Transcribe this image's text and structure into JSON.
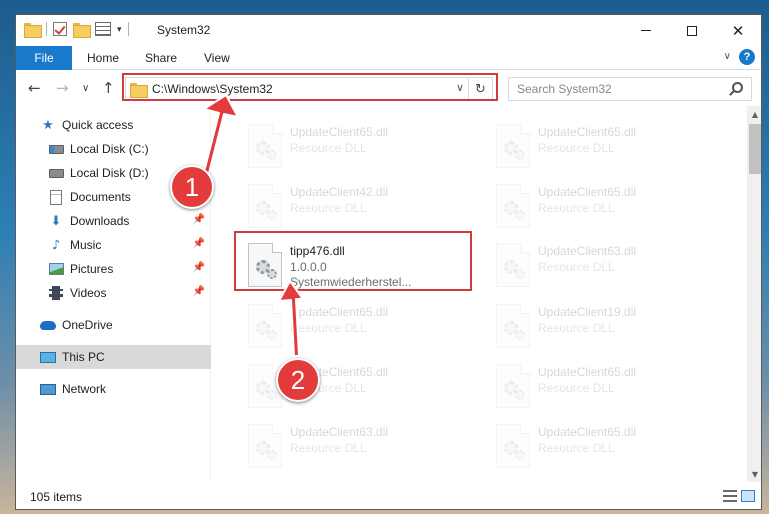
{
  "window": {
    "title": "System32",
    "controls": {
      "minimize": "minimize-icon",
      "maximize": "maximize-icon",
      "close": "✕"
    }
  },
  "ribbon": {
    "file_tab": "File",
    "tabs": [
      "Home",
      "Share",
      "View"
    ],
    "help": "?"
  },
  "navigation": {
    "address": "C:\\Windows\\System32",
    "search_placeholder": "Search System32"
  },
  "sidebar": {
    "items": [
      {
        "label": "Quick access",
        "icon": "star-icon"
      },
      {
        "label": "Local Disk (C:)",
        "icon": "drive-icon",
        "pinned": false
      },
      {
        "label": "Local Disk (D:)",
        "icon": "drive-icon",
        "pinned": false
      },
      {
        "label": "Documents",
        "icon": "document-icon",
        "pinned": false
      },
      {
        "label": "Downloads",
        "icon": "download-icon",
        "pinned": true
      },
      {
        "label": "Music",
        "icon": "music-icon",
        "pinned": true
      },
      {
        "label": "Pictures",
        "icon": "pictures-icon",
        "pinned": true
      },
      {
        "label": "Videos",
        "icon": "videos-icon",
        "pinned": true
      },
      {
        "label": "OneDrive",
        "icon": "cloud-icon"
      },
      {
        "label": "This PC",
        "icon": "computer-icon",
        "selected": true
      },
      {
        "label": "Network",
        "icon": "network-icon"
      }
    ]
  },
  "files": {
    "left_column": [
      {
        "name": "UpdateClient65.dll",
        "line2": "Resource DLL",
        "line3": "",
        "faded": true
      },
      {
        "name": "UpdateClient42.dll",
        "line2": "Resource DLL",
        "line3": "",
        "faded": true
      },
      {
        "name": "tipp476.dll",
        "line2": "1.0.0.0",
        "line3": "Systemwiederherstel...",
        "faded": false
      },
      {
        "name": "UpdateClient65.dll",
        "line2": "Resource DLL",
        "line3": "",
        "faded": true
      },
      {
        "name": "UpdateClient65.dll",
        "line2": "Resource DLL",
        "line3": "",
        "faded": true
      },
      {
        "name": "UpdateClient63.dll",
        "line2": "Resource DLL",
        "line3": "",
        "faded": true
      }
    ],
    "right_column": [
      {
        "name": "UpdateClient65.dll",
        "line2": "Resource DLL",
        "faded": true
      },
      {
        "name": "UpdateClient65.dll",
        "line2": "Resource DLL",
        "faded": true
      },
      {
        "name": "UpdateClient63.dll",
        "line2": "Resource DLL",
        "faded": true
      },
      {
        "name": "UpdateClient19.dll",
        "line2": "Resource DLL",
        "faded": true
      },
      {
        "name": "UpdateClient65.dll",
        "line2": "Resource DLL",
        "faded": true
      },
      {
        "name": "UpdateClient65.dll",
        "line2": "Resource DLL",
        "faded": true
      }
    ]
  },
  "status": {
    "item_count": "105 items"
  },
  "annotations": {
    "step1": "1",
    "step2": "2",
    "color": "#d03c3c"
  },
  "colors": {
    "accent": "#1979ca",
    "highlight": "#d03c3c",
    "selected": "#d9d9d9"
  }
}
